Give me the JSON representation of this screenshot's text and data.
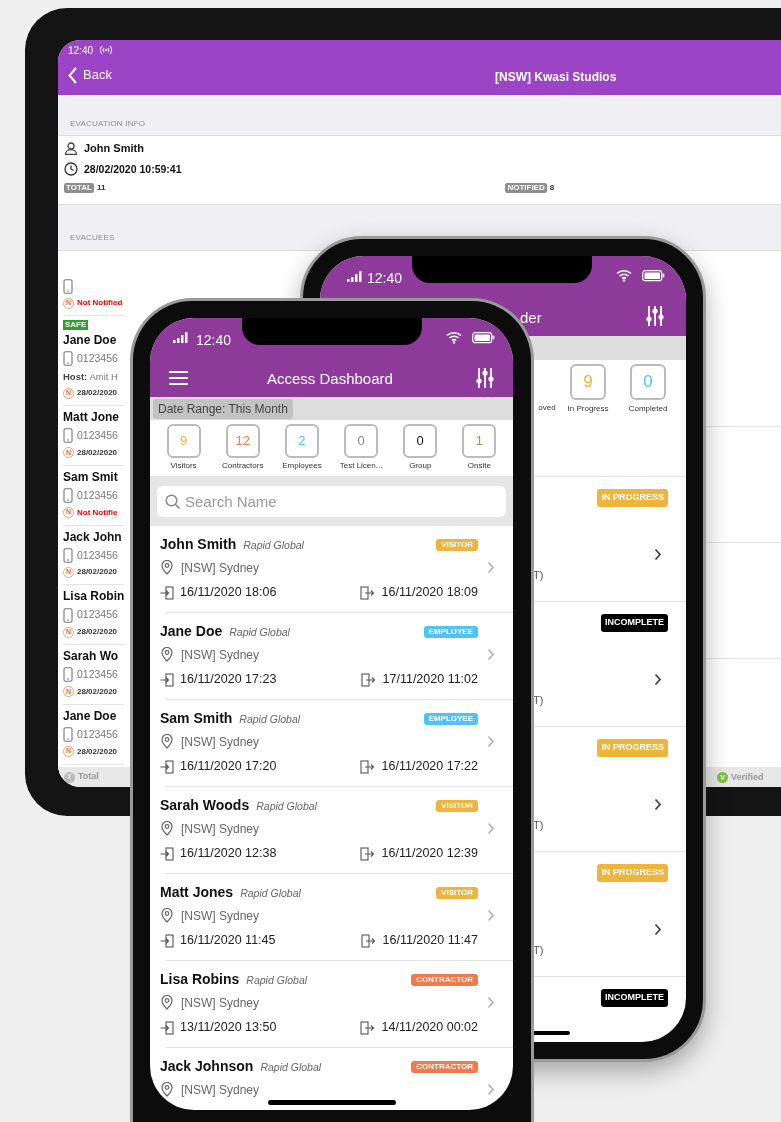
{
  "tablet": {
    "status_time": "12:40",
    "back": "Back",
    "title": "[NSW] Kwasi Studios",
    "evacuation_info": {
      "heading": "EVACUATION INFO",
      "person": "John Smith",
      "datetime": "28/02/2020 10:59:41",
      "total_label": "TOTAL",
      "total": "11",
      "notified_label": "NOTIFIED",
      "notified": "8"
    },
    "evacuees_heading": "EVACUEES",
    "evacuees": [
      {
        "status_icon": "N",
        "notified": false,
        "notice": "Not Notified"
      },
      {
        "badge": "SAFE",
        "name": "Jane Doe",
        "phone": "0123456",
        "host": "**Host:** Amit H",
        "status_icon": "N",
        "notified": true,
        "notice": "28/02/2020"
      },
      {
        "name": "Matt Jone",
        "phone": "0123456",
        "status_icon": "N",
        "notified": true,
        "notice": "28/02/2020"
      },
      {
        "name": "Sam Smit",
        "phone": "0123456",
        "status_icon": "N",
        "notified": false,
        "notice": "Not Notifie"
      },
      {
        "name": "Jack John",
        "phone": "0123456",
        "status_icon": "N",
        "notified": true,
        "notice": "28/02/2020"
      },
      {
        "name": "Lisa Robin",
        "phone": "0123456",
        "status_icon": "N",
        "notified": true,
        "notice": "28/02/2020"
      },
      {
        "name": "Sarah Wo",
        "phone": "0123456",
        "status_icon": "N",
        "notified": true,
        "notice": "28/02/2020"
      },
      {
        "name": "Jane Doe",
        "phone": "0123456",
        "status_icon": "N",
        "notified": true,
        "notice": "28/02/2020"
      }
    ],
    "footer": {
      "total_icon": "T",
      "total": "Total",
      "verified_icon": "V",
      "verified": "Verified"
    }
  },
  "back_phone": {
    "status_time": "12:40",
    "title": "der",
    "stats": [
      {
        "label": "oved"
      },
      {
        "value": "9",
        "label": "In Progress",
        "color": "#efb33a"
      },
      {
        "value": "0",
        "label": "Completed",
        "color": "#4fc3f7"
      }
    ],
    "items": [
      {
        "kind": "in_progress",
        "badge": "IN PROGRESS",
        "tail": "T)"
      },
      {
        "kind": "incomplete",
        "badge": "INCOMPLETE",
        "tail": "T)"
      },
      {
        "kind": "in_progress",
        "badge": "IN PROGRESS",
        "tail": "T)"
      },
      {
        "kind": "in_progress",
        "badge": "IN PROGRESS",
        "tail": "T)"
      },
      {
        "kind": "incomplete",
        "badge": "INCOMPLETE"
      }
    ]
  },
  "front_phone": {
    "status_time": "12:40",
    "title": "Access Dashboard",
    "date_range": "Date Range: This Month",
    "stats": [
      {
        "value": "9",
        "label": "Visitors",
        "color": "#efb33a"
      },
      {
        "value": "12",
        "label": "Contractors",
        "color": "#f47c4f"
      },
      {
        "value": "2",
        "label": "Employees",
        "color": "#4fc3f7"
      },
      {
        "value": "0",
        "label": "Test Licen...",
        "color": "#888888"
      },
      {
        "value": "0",
        "label": "Group",
        "color": "#111111"
      },
      {
        "value": "1",
        "label": "Onsite",
        "color": "#6cbf2c"
      }
    ],
    "search": {
      "placeholder": "Search Name"
    },
    "entries": [
      {
        "name": "John Smith",
        "company": "Rapid Global",
        "kind": "visitor",
        "badge": "VISITOR",
        "location": "[NSW] Sydney",
        "in": "16/11/2020 18:06",
        "out": "16/11/2020 18:09"
      },
      {
        "name": "Jane Doe",
        "company": "Rapid Global",
        "kind": "employee",
        "badge": "EMPLOYEE",
        "location": "[NSW] Sydney",
        "in": "16/11/2020 17:23",
        "out": "17/11/2020 11:02"
      },
      {
        "name": "Sam Smith",
        "company": "Rapid Global",
        "kind": "employee",
        "badge": "EMPLOYEE",
        "location": "[NSW] Sydney",
        "in": "16/11/2020 17:20",
        "out": "16/11/2020 17:22"
      },
      {
        "name": "Sarah Woods",
        "company": "Rapid Global",
        "kind": "visitor",
        "badge": "VISITOR",
        "location": "[NSW] Sydney",
        "in": "16/11/2020 12:38",
        "out": "16/11/2020 12:39"
      },
      {
        "name": "Matt Jones",
        "company": "Rapid Global",
        "kind": "visitor",
        "badge": "VISITOR",
        "location": "[NSW] Sydney",
        "in": "16/11/2020 11:45",
        "out": "16/11/2020 11:47"
      },
      {
        "name": "Lisa Robins",
        "company": "Rapid Global",
        "kind": "contractor",
        "badge": "CONTRACTOR",
        "location": "[NSW] Sydney",
        "in": "13/11/2020 13:50",
        "out": "14/11/2020 00:02"
      },
      {
        "name": "Jack Johnson",
        "company": "Rapid Global",
        "kind": "contractor",
        "badge": "CONTRACTOR",
        "location": "[NSW] Sydney"
      }
    ]
  }
}
